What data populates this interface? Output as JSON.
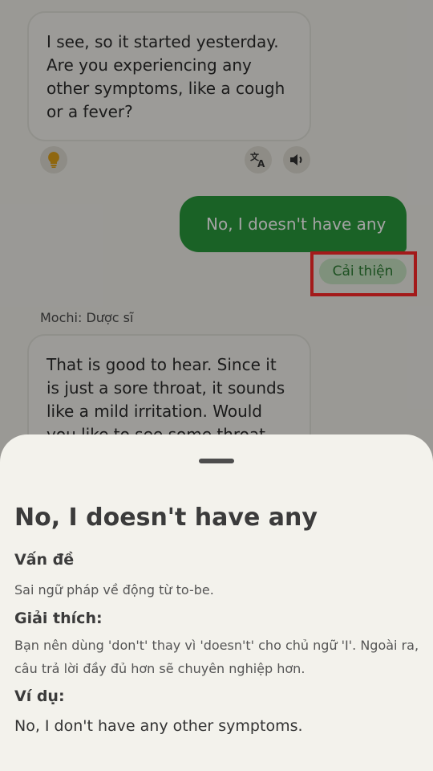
{
  "chat": {
    "bot_message_1": "I see, so it started yesterday. Are you experiencing any other symptoms, like a cough or a fever?",
    "user_message": "No, I doesn't have any",
    "improve_label": "Cải thiện",
    "sender_label": "Mochi: Dược sĩ",
    "bot_message_2": "That is good to hear. Since it is just a sore throat, it sounds like a mild irritation. Would you like to see some throat"
  },
  "icons": {
    "bulb": "lightbulb-icon",
    "translate": "translate-icon",
    "speaker": "speaker-icon"
  },
  "sheet": {
    "title": "No, I doesn't have any",
    "problem_heading": "Vấn đề",
    "problem_text": "Sai ngữ pháp về động từ to-be.",
    "explanation_heading": "Giải thích:",
    "explanation_text": "Bạn nên dùng 'don't' thay vì 'doesn't' cho chủ ngữ 'I'. Ngoài ra, câu trả lời đầy đủ hơn sẽ chuyên nghiệp hơn.",
    "example_heading": "Ví dụ:",
    "example_text": "No, I don't have any other symptoms."
  },
  "colors": {
    "user_bubble": "#2a9a3c",
    "highlight": "#ff2a2a",
    "improve_bg": "#c7e3c3"
  }
}
